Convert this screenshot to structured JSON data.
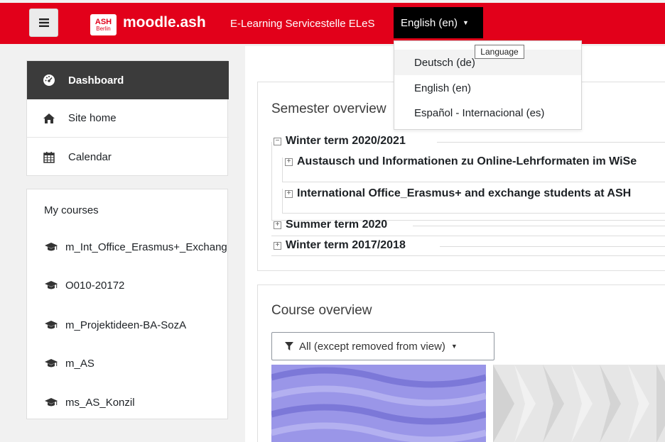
{
  "header": {
    "logo_line1": "ASH",
    "logo_line2": "Berlin",
    "brand": "moodle.ash",
    "link": "E-Learning Servicestelle ELeS",
    "language_button": "English (en)"
  },
  "language_menu": {
    "tooltip": "Language",
    "items": [
      {
        "label": "Deutsch (de)"
      },
      {
        "label": "English (en)"
      },
      {
        "label": "Español - Internacional (es)"
      }
    ]
  },
  "nav": {
    "items": [
      {
        "label": "Dashboard",
        "icon": "dashboard-icon"
      },
      {
        "label": "Site home",
        "icon": "home-icon"
      },
      {
        "label": "Calendar",
        "icon": "calendar-icon"
      }
    ]
  },
  "my_courses": {
    "title": "My courses",
    "items": [
      {
        "label": "m_Int_Office_Erasmus+_Exchange"
      },
      {
        "label": "O010-20172"
      },
      {
        "label": "m_Projektideen-BA-SozA"
      },
      {
        "label": "m_AS"
      },
      {
        "label": "ms_AS_Konzil"
      }
    ]
  },
  "semester_overview": {
    "title": "Semester overview",
    "terms": [
      {
        "label": "Winter term 2020/2021",
        "expanded": true,
        "courses": [
          {
            "label": "Austausch und Informationen zu Online-Lehrformaten im WiSe"
          },
          {
            "label": "International Office_Erasmus+ and exchange students at ASH"
          }
        ]
      },
      {
        "label": "Summer term 2020",
        "expanded": false
      },
      {
        "label": "Winter term 2017/2018",
        "expanded": false
      }
    ]
  },
  "course_overview": {
    "title": "Course overview",
    "filter": "All (except removed from view)"
  },
  "colors": {
    "brand_red": "#e2001a",
    "active_nav": "#3b3b3b",
    "tile1": "#9a96e8",
    "tile2": "#e6e6e6"
  }
}
